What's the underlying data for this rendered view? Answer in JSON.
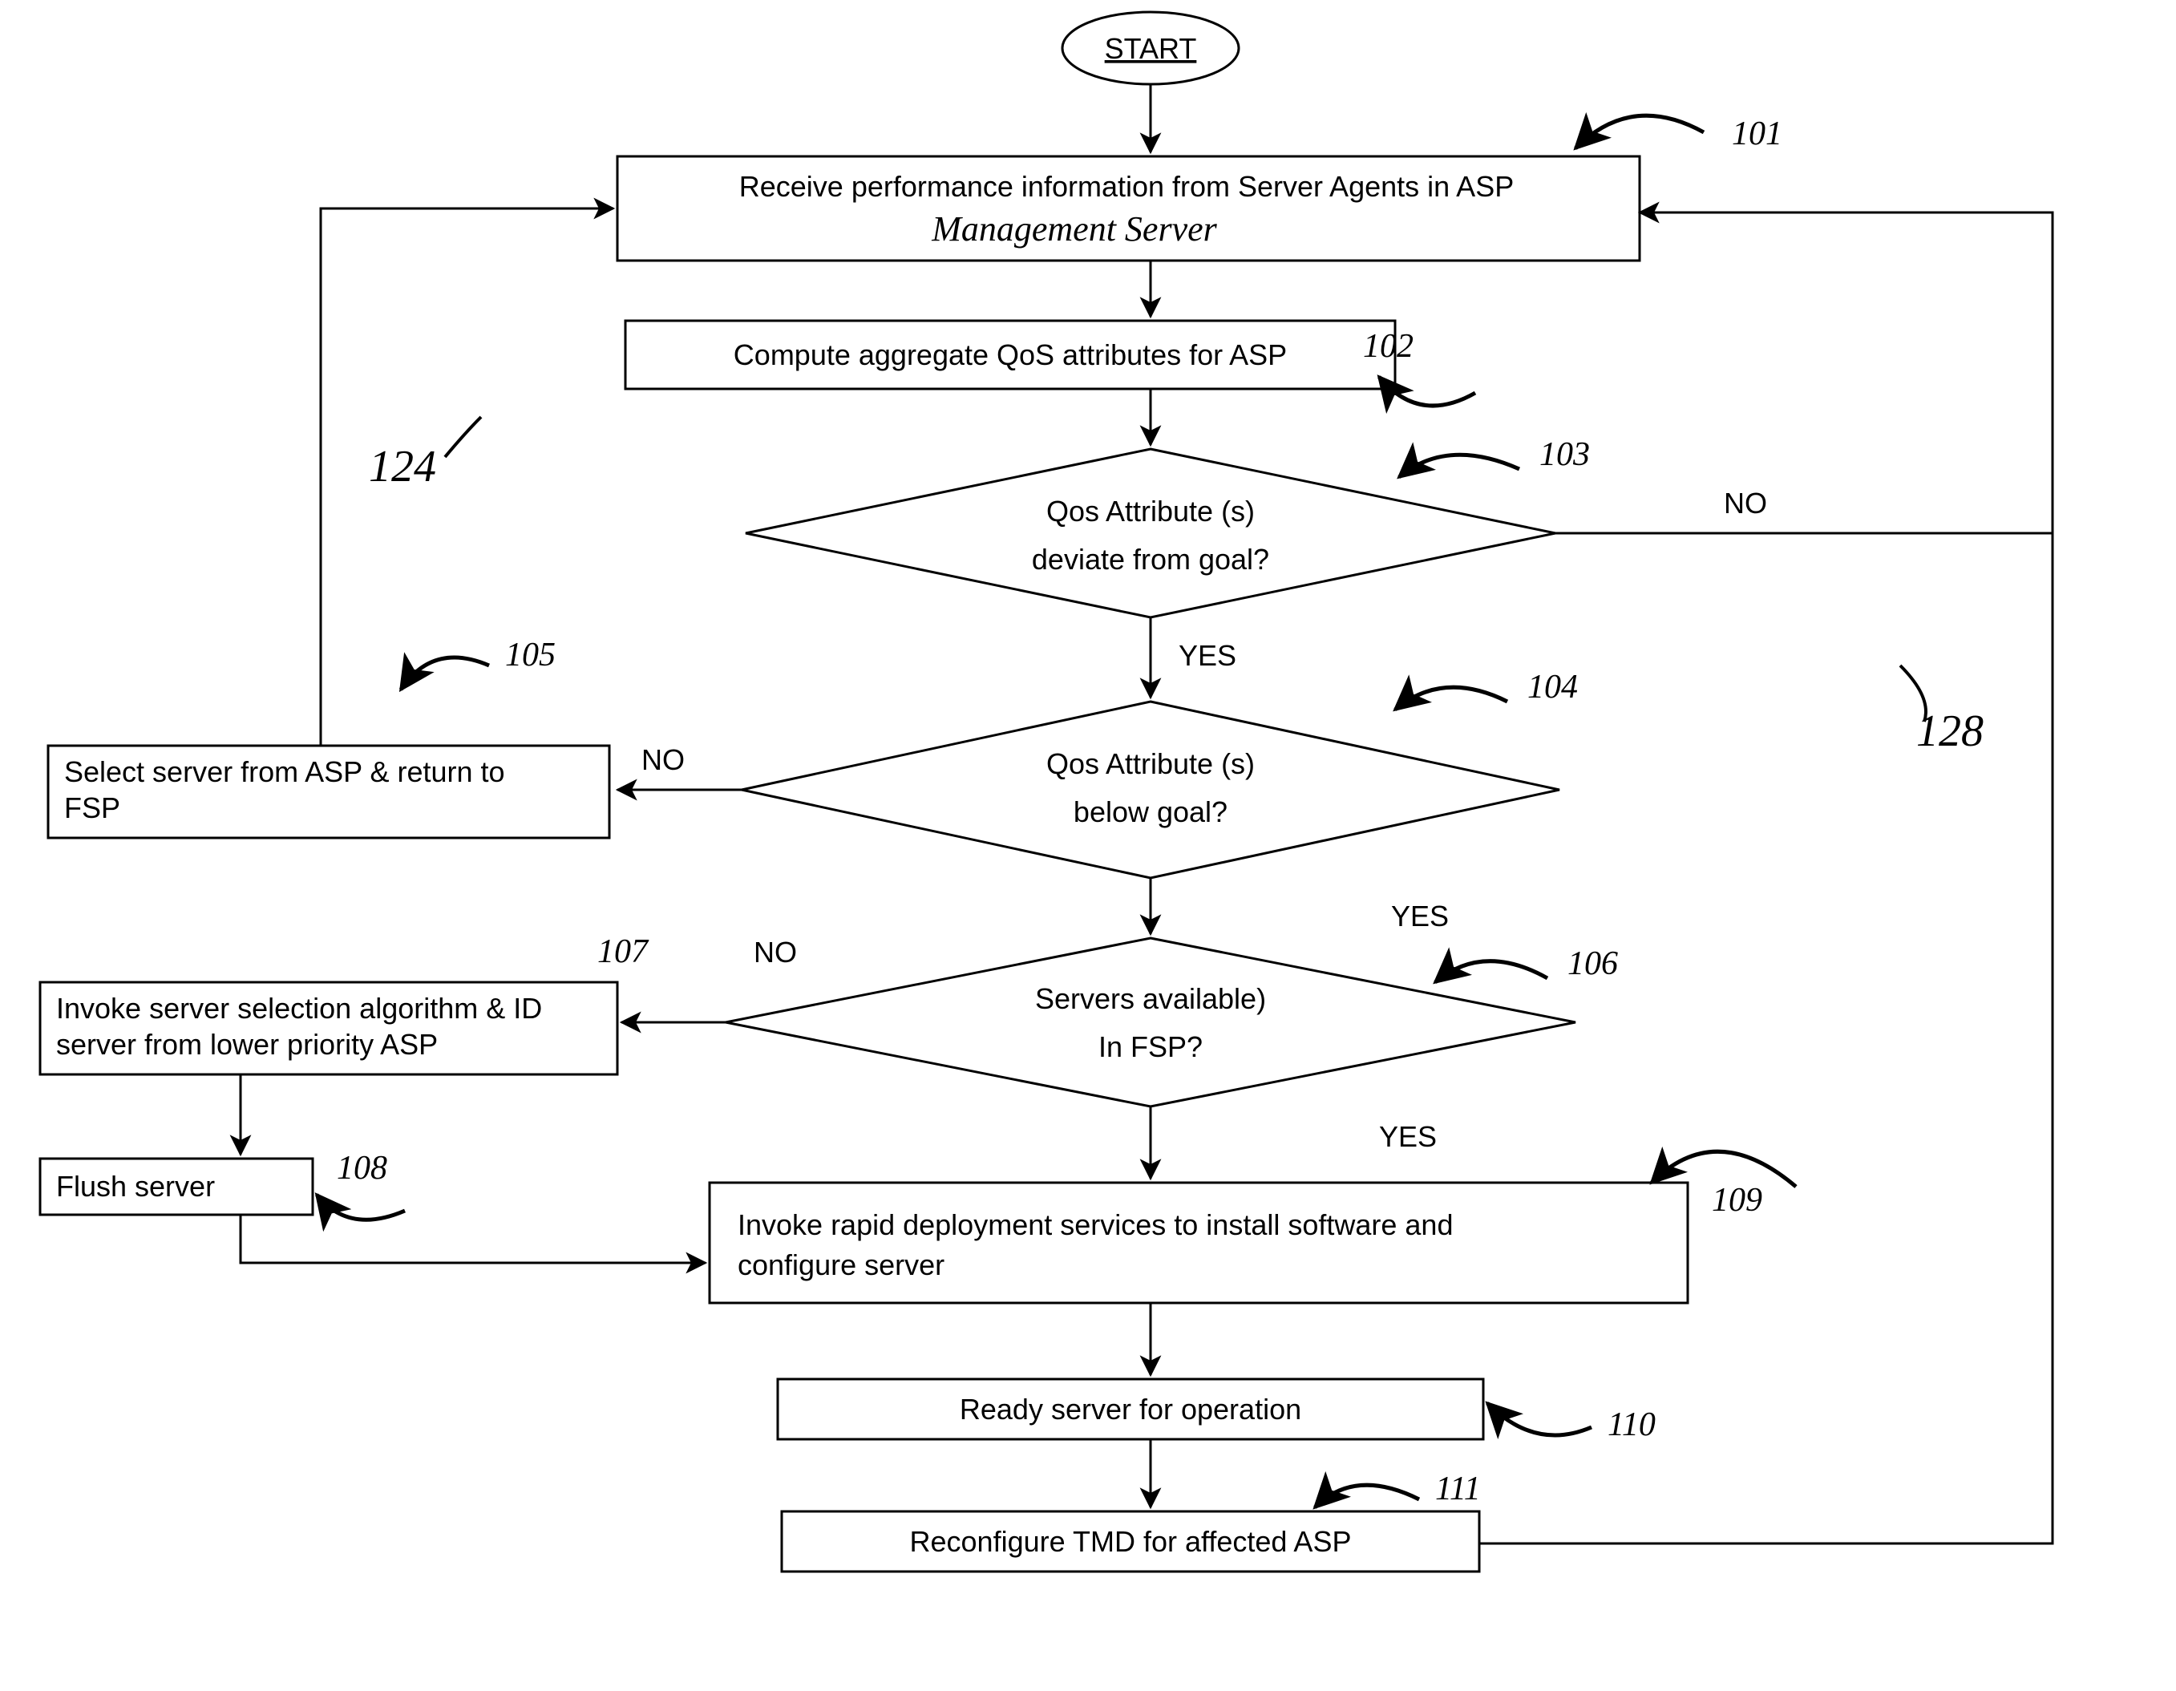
{
  "start": "START",
  "labels": {
    "yes": "YES",
    "no": "NO"
  },
  "nodes": {
    "n101": {
      "line1": "Receive performance information from Server Agents  in ASP",
      "hand": "Management  Server",
      "ref": "101"
    },
    "n102": {
      "text": "Compute aggregate QoS attributes for ASP",
      "ref": "102"
    },
    "n103": {
      "line1": "Qos Attribute (s)",
      "line2": "deviate from goal?",
      "ref": "103"
    },
    "n104": {
      "line1": "Qos Attribute (s)",
      "line2": "below goal?",
      "ref": "104"
    },
    "n105": {
      "text": "Select server from ASP & return to FSP",
      "ref": "105"
    },
    "n106": {
      "line1": "Servers available)",
      "line2": "In FSP?",
      "ref": "106"
    },
    "n107": {
      "text": "Invoke server selection algorithm & ID server from lower priority ASP",
      "ref": "107"
    },
    "n108": {
      "text": "Flush server",
      "ref": "108"
    },
    "n109": {
      "text": "Invoke rapid deployment services to install software and configure server",
      "ref": "109"
    },
    "n110": {
      "text": "Ready server for operation",
      "ref": "110"
    },
    "n111": {
      "text": "Reconfigure TMD for affected ASP",
      "ref": "111"
    }
  },
  "annotations": {
    "a124": "124",
    "a128": "128"
  }
}
